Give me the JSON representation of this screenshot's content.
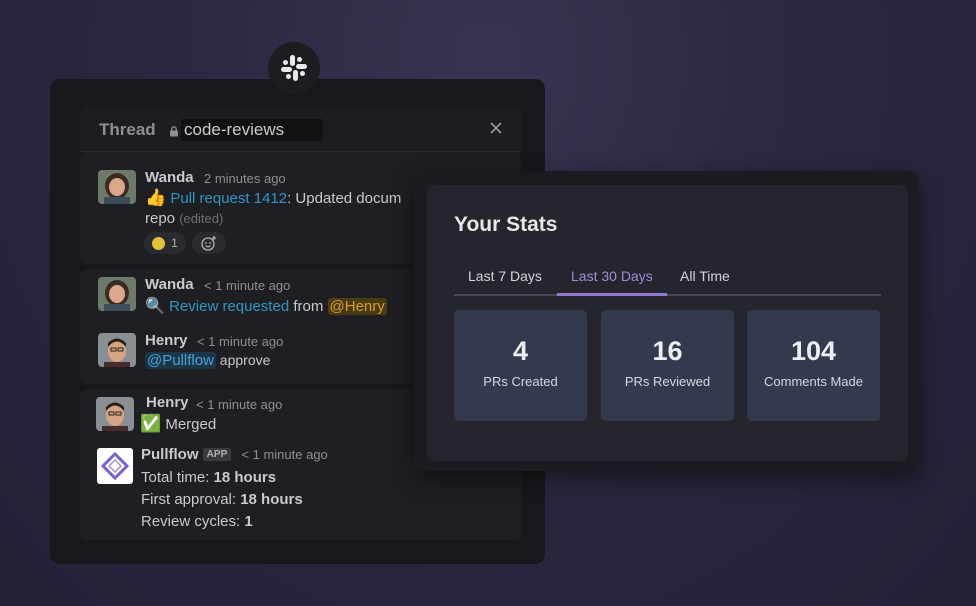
{
  "thread": {
    "title": "Thread",
    "channel": "code-reviews",
    "messages": [
      {
        "author": "Wanda",
        "time": "2 minutes ago",
        "emoji": "👍",
        "link": "Pull request 1412",
        "text": ": Updated docum",
        "text2": "repo",
        "edited": "(edited)",
        "reaction_count": "1"
      },
      {
        "author": "Wanda",
        "time": "< 1 minute ago",
        "emoji": "🔍",
        "link": "Review requested",
        "text": " from ",
        "mention": "@Henry"
      },
      {
        "author": "Henry",
        "time": "< 1 minute ago",
        "mention": "@Pullflow",
        "text": " approve"
      },
      {
        "author": "Henry",
        "time": "< 1 minute ago",
        "emoji": "✅",
        "text": "Merged"
      },
      {
        "author": "Pullflow",
        "badge": "APP",
        "time": "< 1 minute ago",
        "lines": [
          {
            "label": "Total time: ",
            "value": "18 hours"
          },
          {
            "label": "First approval: ",
            "value": "18 hours"
          },
          {
            "label": "Review cycles: ",
            "value": "1"
          }
        ]
      }
    ]
  },
  "stats": {
    "title": "Your Stats",
    "tabs": [
      {
        "label": "Last 7 Days"
      },
      {
        "label": "Last 30 Days"
      },
      {
        "label": "All Time"
      }
    ],
    "active_tab": "Last 30 Days",
    "cards": [
      {
        "value": "4",
        "label": "PRs Created"
      },
      {
        "value": "16",
        "label": "PRs Reviewed"
      },
      {
        "value": "104",
        "label": "Comments Made"
      }
    ]
  },
  "colors": {
    "accent": "#9378cf",
    "link": "#2f96c8",
    "card": "#343a4e"
  }
}
